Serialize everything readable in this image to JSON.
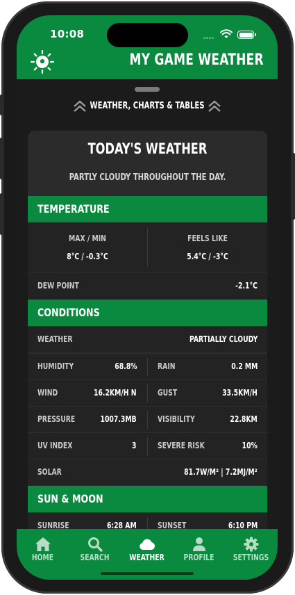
{
  "status_bar": {
    "time": "10:08"
  },
  "header": {
    "title": "MY GAME WEATHER",
    "logo_icon": "soccer-ball-sun-icon"
  },
  "sheet": {
    "label": "WEATHER, CHARTS & TABLES"
  },
  "today": {
    "title": "TODAY'S WEATHER",
    "summary": "PARTLY CLOUDY THROUGHOUT THE DAY."
  },
  "temperature": {
    "heading": "TEMPERATURE",
    "max_min_label": "MAX / MIN",
    "max_min_value": "8°C / -0.3°C",
    "feels_like_label": "FEELS LIKE",
    "feels_like_value": "5.4°C / -3°C",
    "dew_point_label": "DEW POINT",
    "dew_point_value": "-2.1°C"
  },
  "conditions": {
    "heading": "CONDITIONS",
    "weather_label": "WEATHER",
    "weather_value": "PARTIALLY CLOUDY",
    "humidity_label": "HUMIDITY",
    "humidity_value": "68.8%",
    "rain_label": "RAIN",
    "rain_value": "0.2 MM",
    "wind_label": "WIND",
    "wind_value": "16.2KM/H N",
    "gust_label": "GUST",
    "gust_value": "33.5KM/H",
    "pressure_label": "PRESSURE",
    "pressure_value": "1007.3MB",
    "visibility_label": "VISIBILITY",
    "visibility_value": "22.8KM",
    "uv_label": "UV INDEX",
    "uv_value": "3",
    "severe_label": "SEVERE RISK",
    "severe_value": "10%",
    "solar_label": "SOLAR",
    "solar_value": "81.7W/M² | 7.2MJ/M²"
  },
  "sun_moon": {
    "heading": "SUN & MOON",
    "sunrise_label": "SUNRISE",
    "sunrise_value": "6:28 AM",
    "sunset_label": "SUNSET",
    "sunset_value": "6:10 PM"
  },
  "tabs": [
    {
      "label": "HOME",
      "icon": "home-icon"
    },
    {
      "label": "SEARCH",
      "icon": "search-icon"
    },
    {
      "label": "WEATHER",
      "icon": "cloud-icon",
      "active": true
    },
    {
      "label": "PROFILE",
      "icon": "person-icon"
    },
    {
      "label": "SETTINGS",
      "icon": "gear-icon"
    }
  ],
  "colors": {
    "brand_green": "#0a8a3f",
    "background": "#1b1b1b",
    "card": "#2b2b2b"
  }
}
